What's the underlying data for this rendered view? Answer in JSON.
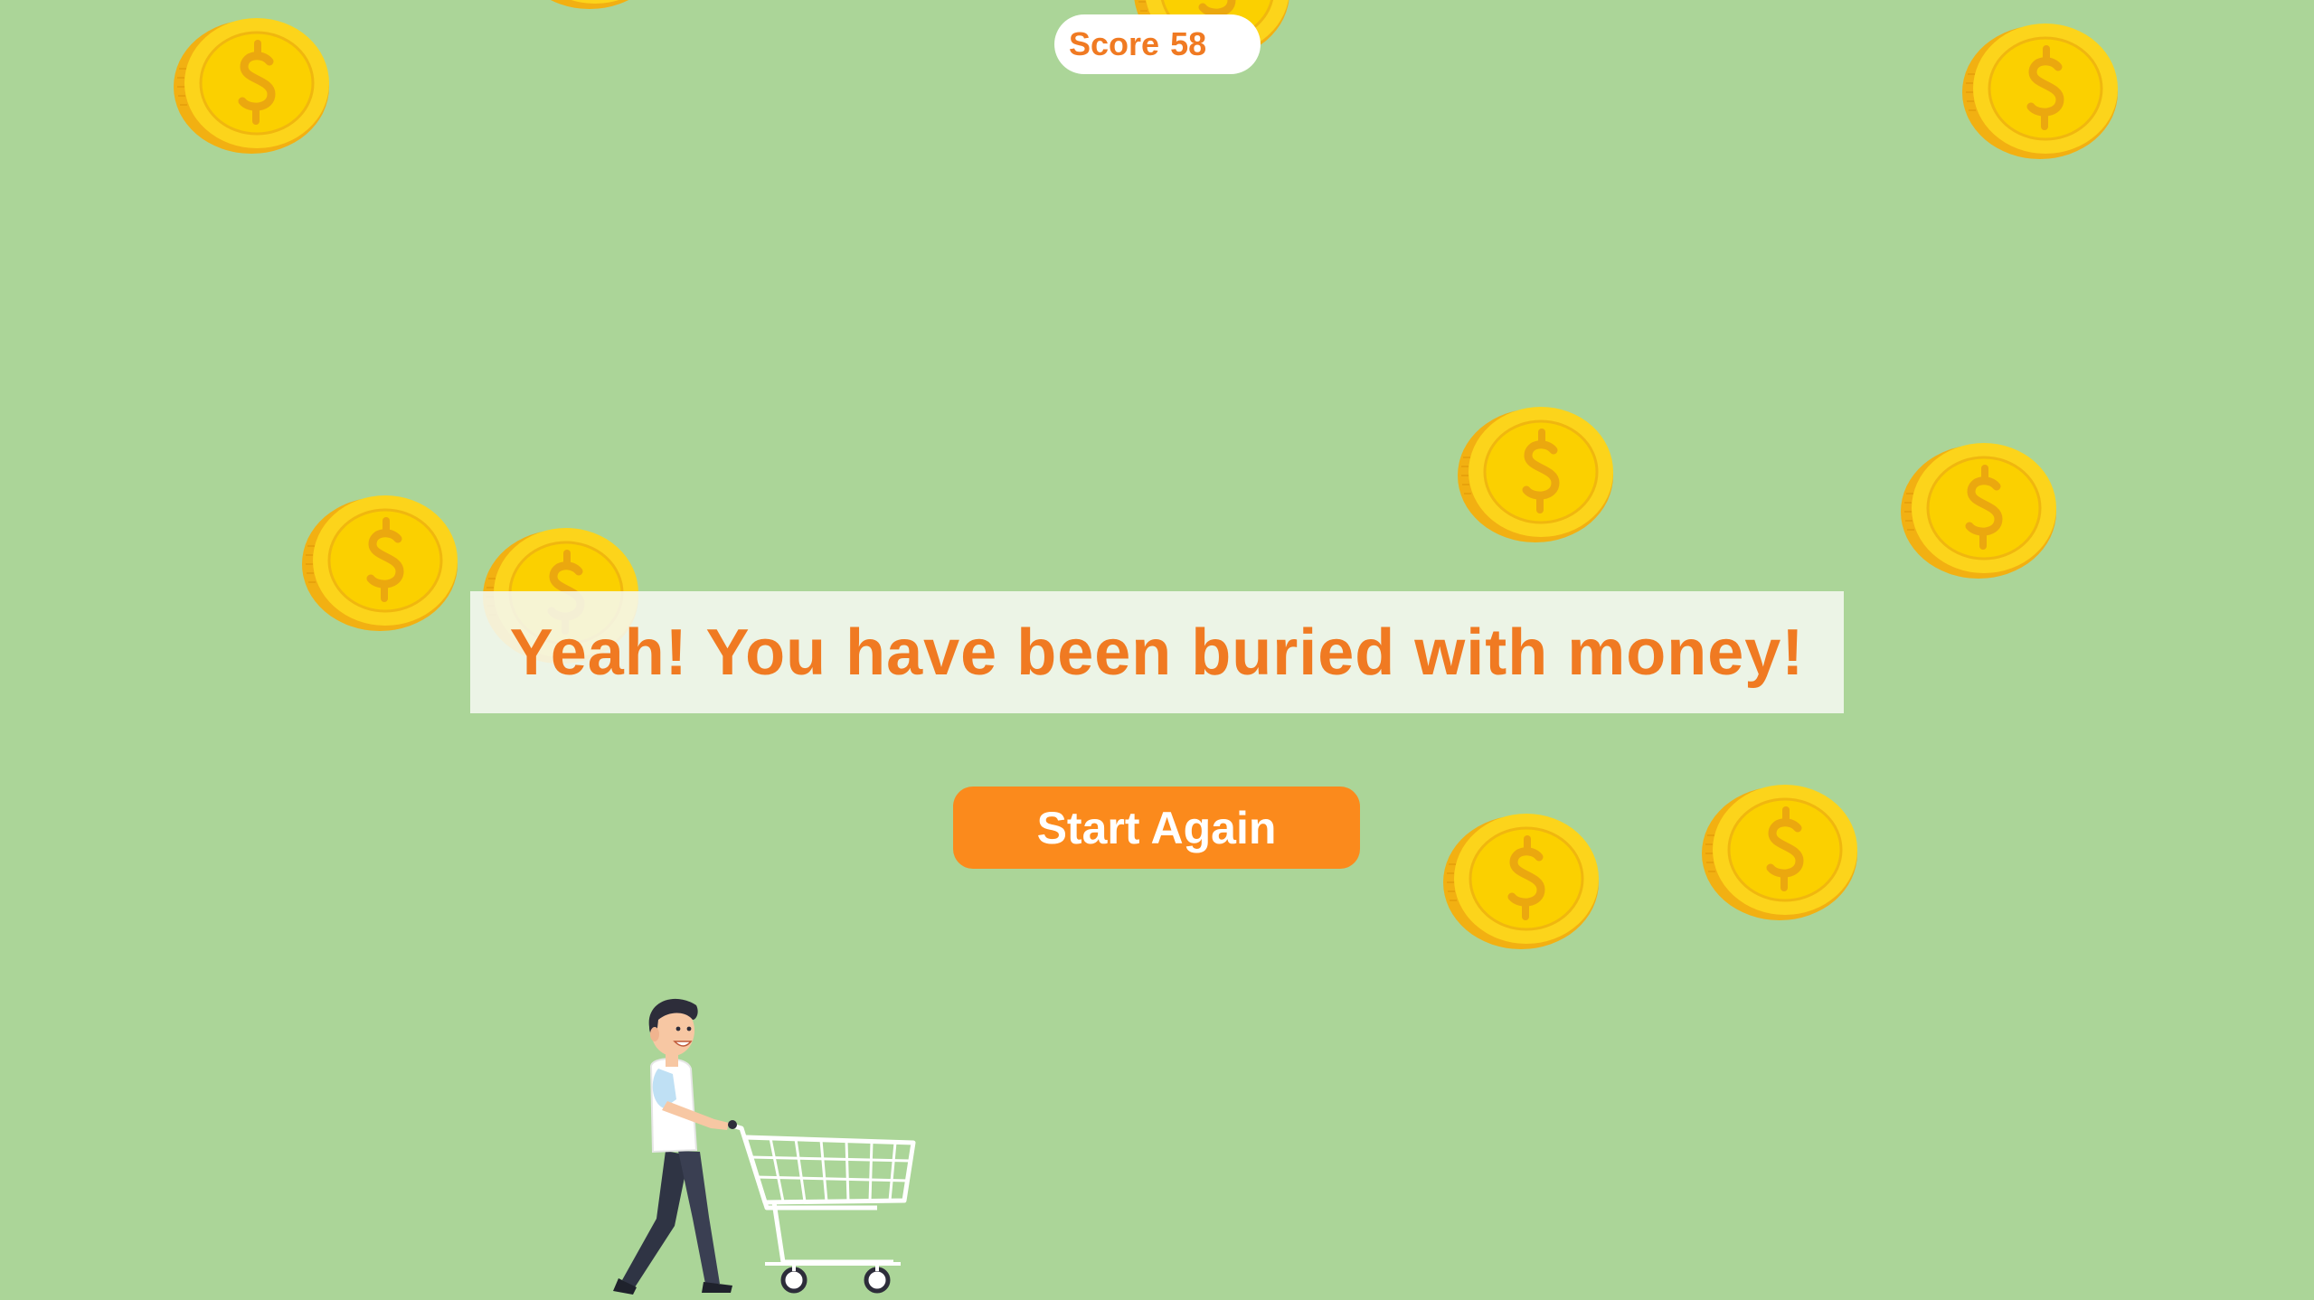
{
  "hud": {
    "score_label": "Score",
    "score_value": "58"
  },
  "message": {
    "text": "Yeah! You have been buried with money!"
  },
  "actions": {
    "start_again_label": "Start Again"
  },
  "colors": {
    "background": "#abd598",
    "accent_orange": "#f07a22",
    "button_orange": "#fb8a1c",
    "coin_gold": "#fcd41b",
    "coin_edge": "#f2b012"
  },
  "sprites": {
    "coin_icon": "dollar-coin-icon",
    "player_icon": "shopper-with-cart-icon"
  }
}
